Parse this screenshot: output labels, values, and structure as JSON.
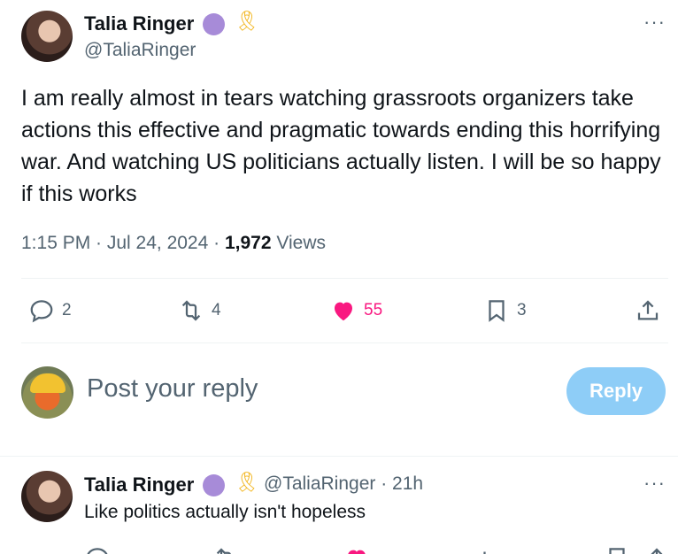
{
  "tweet": {
    "author_name": "Talia Ringer",
    "author_handle": "@TaliaRinger",
    "text": "I am really almost in tears watching grassroots organizers take actions this effective and pragmatic towards ending this horrifying war. And watching US politicians actually listen. I will be so happy if this works",
    "time": "1:15 PM · Jul 24, 2024 · ",
    "views_count": "1,972",
    "views_label": " Views",
    "more": "···"
  },
  "actions": {
    "replies": "2",
    "retweets": "4",
    "likes": "55",
    "bookmarks": "3"
  },
  "composer": {
    "placeholder": "Post your reply",
    "button": "Reply"
  },
  "reply": {
    "author_name": "Talia Ringer",
    "author_handle": "@TaliaRinger",
    "time": " · 21h",
    "text": "Like politics actually isn't hopeless",
    "more": "···"
  },
  "colors": {
    "like": "#f91880",
    "verified": "#a78bd8",
    "reply_button": "#8ecdf7",
    "muted": "#536471"
  }
}
